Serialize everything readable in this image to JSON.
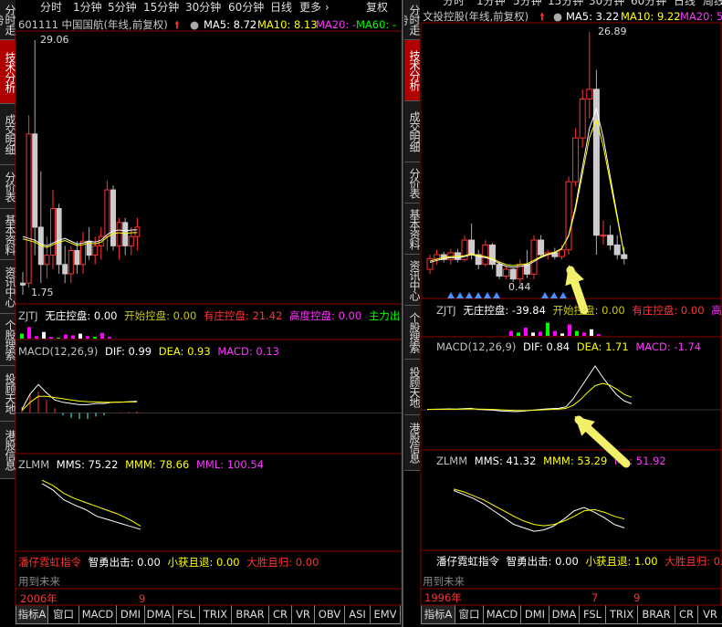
{
  "colors": {
    "up": "#ff3333",
    "down": "#55ffff",
    "ma5": "#ffffff",
    "ma10": "#ffff00",
    "ma20": "#ff33ff",
    "ma60": "#00ff00",
    "grid": "#8b0000",
    "text": "#c0c0c0",
    "arrow": "#f2f06a"
  },
  "side_tabs": {
    "left": [
      "分时走势",
      "技术分析",
      "成交明细",
      "分价表",
      "基本资料",
      "资讯中心",
      "个股搜索",
      "投顾天地",
      "港股信息"
    ],
    "right": [
      "分时走势",
      "技术分析",
      "成交明细",
      "分价表",
      "基本资料",
      "资讯中心",
      "个股搜索",
      "投顾天地",
      "港股信息"
    ]
  },
  "top_tabs": {
    "left": [
      "分时",
      "1分钟",
      "5分钟",
      "15分钟",
      "30分钟",
      "60分钟",
      "日线",
      "更多 ›",
      "复权"
    ],
    "right": [
      "分时",
      "1分钟",
      "5分钟",
      "15分钟",
      "30分钟",
      "60分钟",
      "日线",
      "周线"
    ]
  },
  "left": {
    "title": "601111 中国国航(年线,前复权)",
    "ma5_label": "MA5: 8.72",
    "ma10_label": "MA10: 8.13",
    "ma20_label": "MA20: -",
    "ma60_label": "MA60: -",
    "high_label": "29.06",
    "low_label": "1.75",
    "zjtj": {
      "name": "ZJTJ",
      "a": "无庄控盘: 0.00",
      "b": "开始控盘: 0.00",
      "c": "有庄控盘: 21.42",
      "d": "高度控盘: 0.00",
      "e": "主力出"
    },
    "macd": {
      "name": "MACD(12,26,9)",
      "dif": "DIF: 0.99",
      "dea": "DEA: 0.93",
      "macd": "MACD: 0.13"
    },
    "zlmm": {
      "name": "ZLMM",
      "mms": "MMS: 75.22",
      "mmm": "MMM: 78.66",
      "mml": "MML: 100.54"
    },
    "hx": {
      "name": "潘仔霓虹指令",
      "a": "智勇出击: 0.00",
      "b": "小获且退: 0.00",
      "c": "大胜且归: 0.00",
      "row": "用到未来"
    },
    "axis": {
      "year": "2006年",
      "mark": "9"
    },
    "tabs": [
      "指标A",
      "窗口",
      "MACD",
      "DMI",
      "DMA",
      "FSL",
      "TRIX",
      "BRAR",
      "CR",
      "VR",
      "OBV",
      "ASI",
      "EMV"
    ]
  },
  "right": {
    "title": "文投控股(年线,前复权)",
    "ma5_label": "MA5: 3.22",
    "ma10_label": "MA10: 9.22",
    "ma20_label": "MA20: 5.",
    "high_label": "26.89",
    "low_label": "0.44",
    "zjtj": {
      "name": "ZJTJ",
      "a": "无庄控盘: -39.84",
      "b": "开始控盘: 0.00",
      "c": "有庄控盘: 0.00",
      "d": "高度"
    },
    "macd": {
      "name": "MACD(12,26,9)",
      "dif": "DIF: 0.84",
      "dea": "DEA: 1.71",
      "macd": "MACD: -1.74"
    },
    "zlmm": {
      "name": "ZLMM",
      "mms": "MMS: 41.32",
      "mmm": "MMM: 53.29",
      "mml": "ML: 51.92"
    },
    "hx": {
      "name": "潘仔霓虹指令",
      "a": "智勇出击: 0.00",
      "b": "小获且退: 1.00",
      "c": "大胜且归: 0.",
      "row": "用到未来"
    },
    "axis": {
      "year": "1996年",
      "mark": "7",
      "mark2": "9"
    },
    "tabs": [
      "指标A",
      "窗口",
      "MACD",
      "DMI",
      "DMA",
      "FSL",
      "TRIX",
      "BRAR",
      "CR",
      "VR"
    ]
  },
  "chart_data": [
    {
      "type": "candlestick",
      "title": "601111 中国国航(年线,前复权)",
      "y_high": 29.06,
      "y_low": 1.75,
      "candles": [
        [
          3,
          4.2,
          1.75,
          2.8
        ],
        [
          3,
          21,
          2.5,
          19
        ],
        [
          19,
          29.06,
          6,
          9
        ],
        [
          9,
          15,
          3,
          5
        ],
        [
          5,
          8,
          3.5,
          6
        ],
        [
          6,
          13,
          4.5,
          11
        ],
        [
          11,
          11.5,
          4,
          5
        ],
        [
          5,
          7,
          3,
          4
        ],
        [
          4,
          7,
          3,
          6.5
        ],
        [
          6.5,
          7.5,
          4,
          5
        ],
        [
          5,
          8.5,
          4,
          7.5
        ],
        [
          7.5,
          9,
          5.5,
          6
        ],
        [
          6,
          8,
          5,
          7
        ],
        [
          7,
          9,
          5.5,
          8
        ],
        [
          8,
          14,
          6.5,
          13
        ],
        [
          13,
          13.5,
          6.5,
          7
        ],
        [
          7,
          10,
          5.5,
          9.5
        ],
        [
          9.5,
          10,
          6,
          7
        ],
        [
          7,
          9,
          6,
          8
        ],
        [
          8,
          10,
          6.5,
          9
        ]
      ],
      "ma5": [
        8,
        7.8,
        7.6,
        7.2,
        7,
        7.3,
        7.6,
        7.8,
        7.5,
        7.2,
        7.3,
        7.5,
        7.4,
        7.6,
        8.2,
        8.6,
        8.7,
        8.6,
        8.7,
        8.72
      ],
      "macd": {
        "dif": [
          0.3,
          1.6,
          2.4,
          1.7,
          1.1,
          0.9,
          0.8,
          0.7,
          0.7,
          0.8,
          0.8,
          0.9,
          0.9,
          0.95,
          0.99
        ],
        "dea": [
          0.2,
          0.9,
          1.4,
          1.4,
          1.3,
          1.2,
          1.1,
          1.0,
          0.95,
          0.93,
          0.9,
          0.9,
          0.92,
          0.93,
          0.93
        ],
        "hist": [
          0.5,
          1.6,
          1.8,
          1.1,
          0.4,
          -0.2,
          -0.4,
          -0.5,
          -0.5,
          -0.3,
          -0.2,
          0.0,
          0.05,
          0.1,
          0.13
        ]
      },
      "zlmm": {
        "mms": [
          95,
          85,
          70,
          62,
          55,
          45,
          40,
          35,
          30,
          25
        ],
        "mmm": [
          100,
          92,
          80,
          72,
          66,
          60,
          54,
          48,
          40,
          30
        ]
      },
      "vol": [
        0.3,
        0.7,
        0.15,
        0.4,
        0.1,
        0.05,
        0.25,
        0.2,
        0.3,
        0.15,
        0.1,
        0.35,
        0.1
      ]
    },
    {
      "type": "candlestick",
      "title": "文投控股(年线,前复权)",
      "y_high": 26.89,
      "y_low": 0.44,
      "candles": [
        [
          2.5,
          4,
          2,
          3.6
        ],
        [
          3.6,
          4.5,
          3,
          4
        ],
        [
          4,
          4.3,
          3.2,
          3.5
        ],
        [
          3.5,
          4.6,
          3,
          4.2
        ],
        [
          4.2,
          4.6,
          3.2,
          3.5
        ],
        [
          3.5,
          6,
          3.3,
          5.5
        ],
        [
          5.5,
          7.2,
          3.5,
          4
        ],
        [
          4,
          4.5,
          2.5,
          3
        ],
        [
          3,
          5.5,
          2.8,
          5
        ],
        [
          5,
          5.2,
          2.5,
          3
        ],
        [
          3,
          3.3,
          1.5,
          1.8
        ],
        [
          1.8,
          2.8,
          1.5,
          2.5
        ],
        [
          2.5,
          2.6,
          1.2,
          1.5
        ],
        [
          1.5,
          3.5,
          1,
          3
        ],
        [
          3,
          4.5,
          1.6,
          2
        ],
        [
          2,
          6,
          1.5,
          5.5
        ],
        [
          5.5,
          6,
          3.8,
          4
        ],
        [
          4,
          4.5,
          3.5,
          4.2
        ],
        [
          4.2,
          4.7,
          3.5,
          3.8
        ],
        [
          3.8,
          5,
          3.5,
          4.5
        ],
        [
          4.5,
          12,
          4,
          11.5
        ],
        [
          11.5,
          17,
          11,
          16
        ],
        [
          16,
          21,
          15,
          20
        ],
        [
          20,
          26.89,
          18,
          21
        ],
        [
          21,
          23,
          4,
          6
        ],
        [
          6,
          7.5,
          5,
          6
        ],
        [
          6,
          7,
          4.5,
          5
        ],
        [
          5,
          6,
          3.5,
          4
        ],
        [
          4,
          4.8,
          3,
          3.6
        ]
      ],
      "ma5": [
        3.2,
        3.4,
        3.6,
        3.7,
        3.7,
        3.8,
        4,
        3.8,
        3.7,
        3.5,
        3.1,
        2.8,
        2.7,
        2.8,
        2.9,
        3.3,
        3.7,
        4,
        4.2,
        4.6,
        6,
        9,
        13,
        17,
        19,
        16,
        12,
        8,
        4
      ],
      "macd": {
        "dif": [
          0.05,
          0.08,
          0.1,
          0.12,
          0.1,
          0.15,
          0.2,
          0.05,
          0,
          -0.05,
          -0.15,
          -0.2,
          -0.25,
          -0.2,
          -0.1,
          0,
          0.1,
          0.15,
          0.2,
          0.4,
          1.5,
          3.0,
          4.5,
          6.0,
          4.5,
          3.2,
          2.0,
          1.2,
          0.84
        ],
        "dea": [
          0.05,
          0.06,
          0.07,
          0.08,
          0.08,
          0.1,
          0.12,
          0.1,
          0.08,
          0.05,
          0,
          -0.05,
          -0.1,
          -0.12,
          -0.1,
          -0.05,
          0,
          0.05,
          0.1,
          0.2,
          0.6,
          1.4,
          2.4,
          3.3,
          3.6,
          3.4,
          2.8,
          2.1,
          1.71
        ]
      },
      "zlmm": {
        "mms": [
          80,
          74,
          68,
          60,
          50,
          40,
          30,
          25,
          20,
          22,
          28,
          38,
          50,
          55,
          48,
          40,
          30,
          25
        ],
        "mmm": [
          82,
          78,
          72,
          66,
          58,
          50,
          42,
          35,
          30,
          28,
          30,
          35,
          42,
          50,
          52,
          48,
          42,
          38
        ]
      },
      "vol": [
        0.3,
        0.2,
        0.5,
        0.2,
        0.25,
        0.8,
        0.3,
        0.15,
        0.7,
        0.3,
        0.2,
        0.4,
        0.1
      ]
    }
  ]
}
